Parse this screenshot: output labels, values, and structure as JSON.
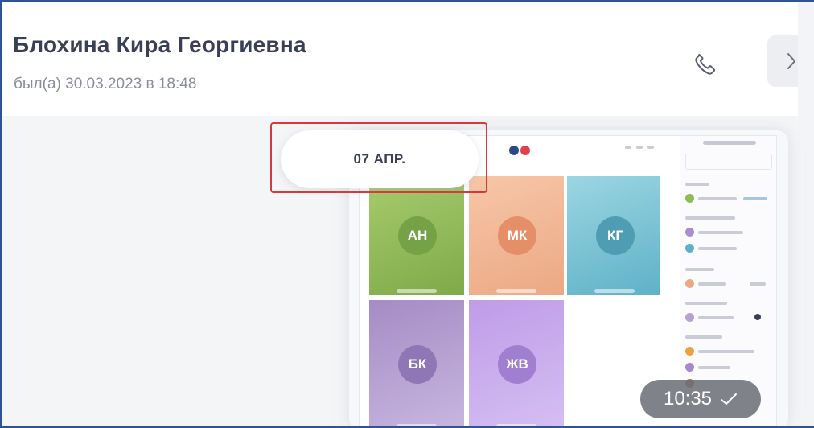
{
  "header": {
    "contact_name": "Блохина Кира Георгиевна",
    "last_seen": "был(а) 30.03.2023 в 18:48"
  },
  "icons": {
    "call": "phone-icon",
    "next": "chevron-right-icon",
    "check": "checkmark-icon"
  },
  "chat": {
    "date_separator": "07 АПР.",
    "message": {
      "time": "10:35"
    }
  },
  "screenshot_preview": {
    "tiles": [
      {
        "initials": "АН",
        "bg": "#8cb85a",
        "avatar": "#7aa84a"
      },
      {
        "initials": "МК",
        "bg": "#f0b795",
        "avatar": "#e6956e"
      },
      {
        "initials": "КГ",
        "bg": "#79c3d3",
        "avatar": "#5aa8bd"
      },
      {
        "initials": "БК",
        "bg": "#b7a1d3",
        "avatar": "#9a83bf"
      },
      {
        "initials": "ЖВ",
        "bg": "#c5a8e8",
        "avatar": "#a887d2"
      }
    ]
  },
  "colors": {
    "highlight": "#d9383f",
    "name_text": "#3a3f58",
    "secondary_text": "#8a8e9a"
  }
}
